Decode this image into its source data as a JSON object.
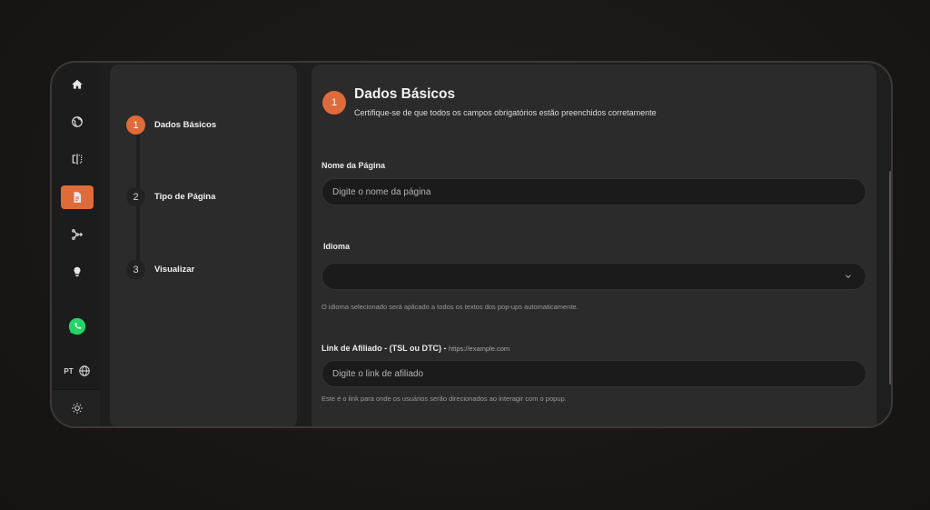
{
  "language": {
    "code": "PT"
  },
  "steps": [
    {
      "number": "1",
      "label": "Dados Básicos"
    },
    {
      "number": "2",
      "label": "Tipo de Página"
    },
    {
      "number": "3",
      "label": "Visualizar"
    }
  ],
  "header": {
    "badge": "1",
    "title": "Dados Básicos",
    "subtitle": "Certifique-se de que todos os campos obrigatórios estão preenchidos corretamente"
  },
  "form": {
    "page_name": {
      "label": "Nome da Página",
      "placeholder": "Digite o nome da página",
      "value": ""
    },
    "language": {
      "label": "Idioma",
      "value": "",
      "help": "O idioma selecionado será aplicado a todos os textos dos pop-ups automaticamente."
    },
    "affiliate_link": {
      "label": "Link de Afiliado - (TSL ou DTC) -",
      "hint": "https://example.com",
      "placeholder": "Digite o link de afiliado",
      "value": "",
      "help": "Este é o link para onde os usuários serão direcionados ao interagir com o popup."
    }
  },
  "colors": {
    "accent": "#e06b3a",
    "panel": "#2b2b2b",
    "input": "#1b1b1b",
    "whatsapp": "#25d366"
  },
  "icons": [
    "home-icon",
    "globe-icon",
    "split-view-icon",
    "document-icon",
    "flow-icon",
    "lightbulb-icon",
    "whatsapp-icon",
    "globe-icon",
    "sun-icon",
    "chevron-down-icon"
  ]
}
